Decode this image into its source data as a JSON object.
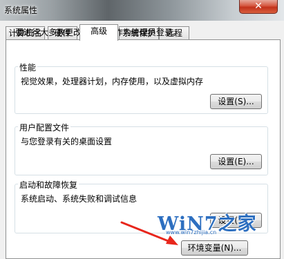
{
  "window": {
    "title": "系统属性",
    "close_label": "✕"
  },
  "tabs": [
    {
      "label": "计算机名"
    },
    {
      "label": "硬件"
    },
    {
      "label": "高级"
    },
    {
      "label": "系统保护"
    },
    {
      "label": "远程"
    }
  ],
  "notice": "要进行大多数更改，您必须作为管理员登录。",
  "performance": {
    "title": "性能",
    "description": "视觉效果，处理器计划，内存使用，以及虚拟内存",
    "button": "设置(S)..."
  },
  "user_profiles": {
    "title": "用户配置文件",
    "description": "与您登录有关的桌面设置",
    "button": "设置(E)..."
  },
  "startup_recovery": {
    "title": "启动和故障恢复",
    "description": "系统启动、系统失败和调试信息",
    "button": "设置(T)..."
  },
  "env_button": "环境变量(N)...",
  "watermark": {
    "main": "WiN7之家",
    "url": "www.win7zhijia.cn"
  },
  "colors": {
    "arrow": "#e8261c",
    "watermark": "#2d6fc0",
    "close": "#c2311b"
  }
}
